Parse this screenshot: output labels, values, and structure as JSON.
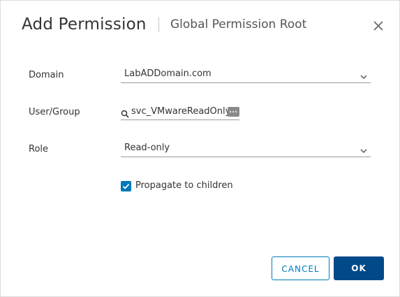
{
  "dialog": {
    "title": "Add Permission",
    "subtitle": "Global Permission Root",
    "close_icon": "close-icon"
  },
  "form": {
    "domain": {
      "label": "Domain",
      "value": "LabADDomain.com"
    },
    "user_group": {
      "label": "User/Group",
      "value": "svc_VMwareReadOnly"
    },
    "role": {
      "label": "Role",
      "value": "Read-only"
    },
    "propagate": {
      "label": "Propagate to children",
      "checked": true
    }
  },
  "buttons": {
    "cancel": "CANCEL",
    "ok": "OK"
  },
  "colors": {
    "accent": "#0079b8",
    "primary_button": "#004a8a"
  }
}
